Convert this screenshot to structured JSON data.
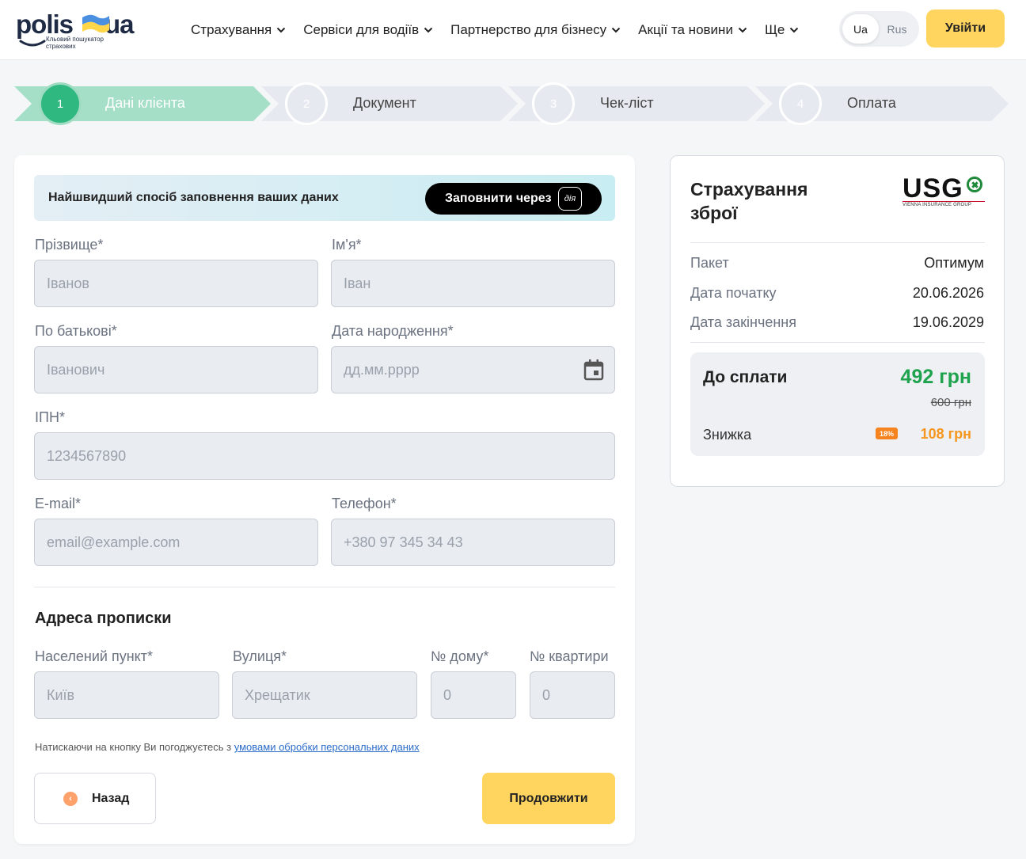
{
  "header": {
    "logo": {
      "word": "polis",
      "suffix": "ua",
      "tagline": "Кльовий пошукатор страхових"
    },
    "nav": [
      {
        "label": "Страхування"
      },
      {
        "label": "Сервіси для водіїв"
      },
      {
        "label": "Партнерство для бізнесу"
      },
      {
        "label": "Акції та новини"
      },
      {
        "label": "Ще"
      }
    ],
    "lang": {
      "ua": "Ua",
      "ru": "Rus",
      "active": "Ua"
    },
    "login_label": "Увійти"
  },
  "stepper": {
    "active": 1,
    "steps": [
      {
        "num": "1",
        "label": "Дані клієнта"
      },
      {
        "num": "2",
        "label": "Документ"
      },
      {
        "num": "3",
        "label": "Чек-ліст"
      },
      {
        "num": "4",
        "label": "Оплата"
      }
    ]
  },
  "form": {
    "diia_banner": {
      "text": "Найшвидший спосіб заповнення ваших даних",
      "button": "Заповнити через",
      "logo_text": "дія"
    },
    "fields": {
      "surname": {
        "label": "Прізвище*",
        "placeholder": "Іванов"
      },
      "name": {
        "label": "Ім'я*",
        "placeholder": "Іван"
      },
      "patronymic": {
        "label": "По батькові*",
        "placeholder": "Іванович"
      },
      "birthdate": {
        "label": "Дата народження*",
        "placeholder": "дд.мм.рррр"
      },
      "ipn": {
        "label": "ІПН*",
        "placeholder": "1234567890"
      },
      "email": {
        "label": "E-mail*",
        "placeholder": "email@example.com"
      },
      "phone": {
        "label": "Телефон*",
        "placeholder": "+380 97 345 34 43"
      }
    },
    "address": {
      "title": "Адреса прописки",
      "city": {
        "label": "Населений пункт*",
        "placeholder": "Київ"
      },
      "street": {
        "label": "Вулиця*",
        "placeholder": "Хрещатик"
      },
      "house": {
        "label": "№ дому*",
        "placeholder": "0"
      },
      "apartment": {
        "label": "№ квартири",
        "placeholder": "0"
      }
    },
    "consent": {
      "text": "Натискаючи на кнопку Ви погоджуєтесь з ",
      "link": "умовами обробки персональних даних"
    },
    "back_label": "Назад",
    "next_label": "Продовжити"
  },
  "summary": {
    "title": "Страхування зброї",
    "insurer": {
      "name": "USG",
      "subtitle": "VIENNA INSURANCE GROUP"
    },
    "rows": [
      {
        "key": "Пакет",
        "value": "Оптимум"
      },
      {
        "key": "Дата початку",
        "value": "20.06.2026"
      },
      {
        "key": "Дата закінчення",
        "value": "19.06.2029"
      }
    ],
    "payment": {
      "label": "До сплати",
      "price": "492 грн",
      "old_price": "600 грн",
      "discount_label": "Знижка",
      "discount_badge": "18%",
      "discount_value": "108 грн"
    }
  },
  "colors": {
    "accent_yellow": "#ffd45f",
    "step_active": "#a6dfc7",
    "step_circle_active": "#2fb880",
    "price_green": "#1fa34f",
    "discount_orange": "#f5841f"
  }
}
